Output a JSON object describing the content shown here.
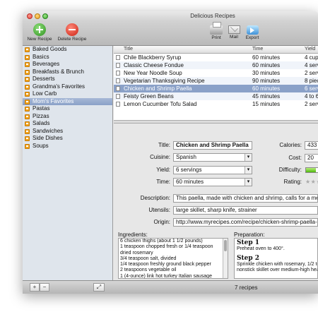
{
  "window": {
    "title": "Delicious Recipes"
  },
  "toolbar": {
    "new_recipe": "New Recipe",
    "delete_recipe": "Delete Recipe",
    "print": "Print",
    "mail": "Mail",
    "export": "Export"
  },
  "sidebar": {
    "items": [
      {
        "label": "Baked Goods"
      },
      {
        "label": "Basics"
      },
      {
        "label": "Beverages"
      },
      {
        "label": "Breakfasts & Brunch"
      },
      {
        "label": "Desserts"
      },
      {
        "label": "Grandma's Favorites"
      },
      {
        "label": "Low Carb"
      },
      {
        "label": "Mom's Favorites"
      },
      {
        "label": "Pastas"
      },
      {
        "label": "Pizzas"
      },
      {
        "label": "Salads"
      },
      {
        "label": "Sandwiches"
      },
      {
        "label": "Side Dishes"
      },
      {
        "label": "Soups"
      }
    ],
    "selected_index": 7
  },
  "list": {
    "columns": [
      "Title",
      "Time",
      "Yield"
    ],
    "rows": [
      [
        "Chile Blackberry Syrup",
        "60 minutes",
        "4 cups"
      ],
      [
        "Classic Cheese Fondue",
        "60 minutes",
        "4 serv"
      ],
      [
        "New Year Noodle Soup",
        "30 minutes",
        "2 serv"
      ],
      [
        "Vegetarian Thanksgiving Recipe",
        "90 minutes",
        "8 piec"
      ],
      [
        "Chicken and Shrimp Paella",
        "60 minutes",
        "6 serv"
      ],
      [
        "Feisty Green Beans",
        "45 minutes",
        "4 to 6"
      ],
      [
        "Lemon Cucumber Tofu Salad",
        "15 minutes",
        "2 serv"
      ]
    ],
    "selected_index": 4
  },
  "detail": {
    "title_label": "Title:",
    "title": "Chicken and Shrimp Paella",
    "cuisine_label": "Cuisine:",
    "cuisine": "Spanish",
    "yield_label": "Yield:",
    "yield": "6 servings",
    "time_label": "Time:",
    "time": "60 minutes",
    "calories_label": "Calories:",
    "calories": "433",
    "cost_label": "Cost:",
    "cost": "20",
    "difficulty_label": "Difficulty:",
    "difficulty_fraction": 0.45,
    "rating_label": "Rating:",
    "rating_stars": "★★★★★",
    "description_label": "Description:",
    "description": "This paella, made with chicken and shrimp, calls for a medium-",
    "utensils_label": "Utensils:",
    "utensils": "large skillet, sharp knife, strainer",
    "origin_label": "Origin:",
    "origin": "http://www.myrecipes.com/recipe/chicken-shrimp-paella-100",
    "ingredients_label": "Ingredients:",
    "ingredients": [
      "6 chicken thighs (about 1 1/2 pounds)",
      "1 teaspoon chopped fresh or 1/4 teaspoon",
      "dried rosemary",
      "3/4 teaspoon salt, divided",
      "1/4 teaspoon freshly ground black pepper",
      "2 teaspoons vegetable oil",
      "1 (4-ounce) link hot turkey Italian sausage"
    ],
    "preparation_label": "Preparation:",
    "steps": [
      {
        "heading": "Step 1",
        "text": "Preheat oven to 400°."
      },
      {
        "heading": "Step 2",
        "text": "Sprinkle chicken with rosemary, 1/2 tea",
        "text2": "nonstick skillet over medium-high heat"
      }
    ]
  },
  "status": {
    "count": "7 recipes"
  },
  "bottom": {
    "add": "+",
    "remove": "−",
    "fullscreen": "⤢"
  }
}
